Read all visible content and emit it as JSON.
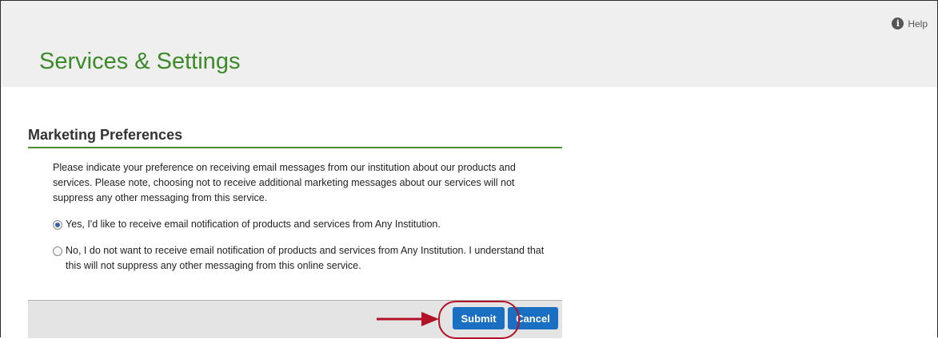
{
  "header": {
    "title": "Services & Settings",
    "help_label": "Help",
    "help_icon": "info-icon"
  },
  "section": {
    "title": "Marketing Preferences",
    "description": "Please indicate your preference on receiving email messages from our institution about our products and services. Please note, choosing not to receive additional marketing messages about our services will not suppress any other messaging from this service.",
    "options": [
      {
        "label": "Yes, I'd like to receive email notification of products and services from Any Institution.",
        "selected": true
      },
      {
        "label": "No, I do not want to receive email notification of products and services from Any Institution. I understand that this will not suppress any other messaging from this online service.",
        "selected": false
      }
    ]
  },
  "actions": {
    "submit_label": "Submit",
    "cancel_label": "Cancel"
  },
  "annotation": {
    "arrow_color": "#b11226",
    "ring_color": "#b11226"
  },
  "colors": {
    "title_green": "#3d8a2a",
    "button_blue": "#1a6fc2",
    "header_bg": "#efefef"
  }
}
